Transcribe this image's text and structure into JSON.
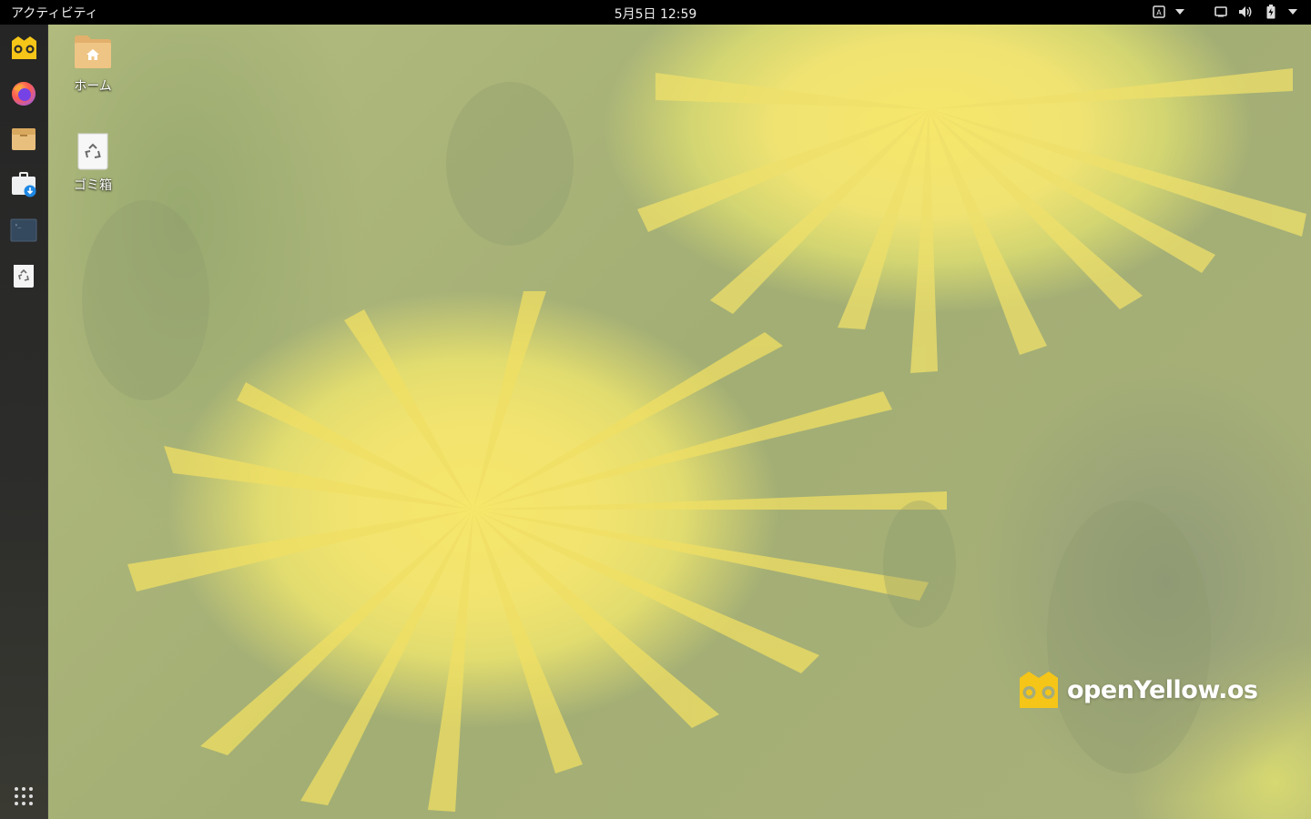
{
  "topbar": {
    "activities_label": "アクティビティ",
    "clock": "5月5日  12:59",
    "indicators": [
      "keyboard-input-icon",
      "dropdown-icon",
      "display-icon",
      "volume-icon",
      "battery-icon",
      "system-menu-icon"
    ]
  },
  "dock": {
    "items": [
      "openyellow-icon",
      "firefox-icon",
      "files-icon",
      "software-icon",
      "terminal-icon",
      "trash-icon"
    ],
    "app_grid": "app-grid-icon"
  },
  "desktop": {
    "home_label": "ホーム",
    "trash_label": "ゴミ箱"
  },
  "brand": {
    "text": "openYellow.os"
  },
  "colors": {
    "topbar": "#000000",
    "dock": "#2b2b29",
    "accent_yellow": "#f5d23b",
    "folder_tan": "#e9bf7e"
  }
}
